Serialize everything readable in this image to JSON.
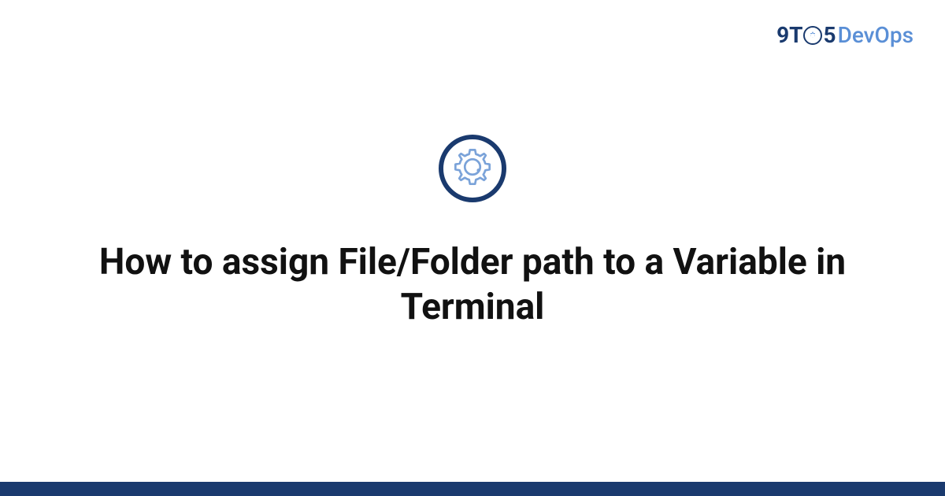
{
  "logo": {
    "prefix": "9T",
    "middle": "5",
    "suffix": "DevOps"
  },
  "icon": {
    "name": "gear-icon"
  },
  "title": "How to assign File/Folder path to a Variable in Terminal",
  "colors": {
    "brand_dark": "#1a3a6e",
    "brand_light": "#5a8fd6",
    "text": "#111111"
  }
}
